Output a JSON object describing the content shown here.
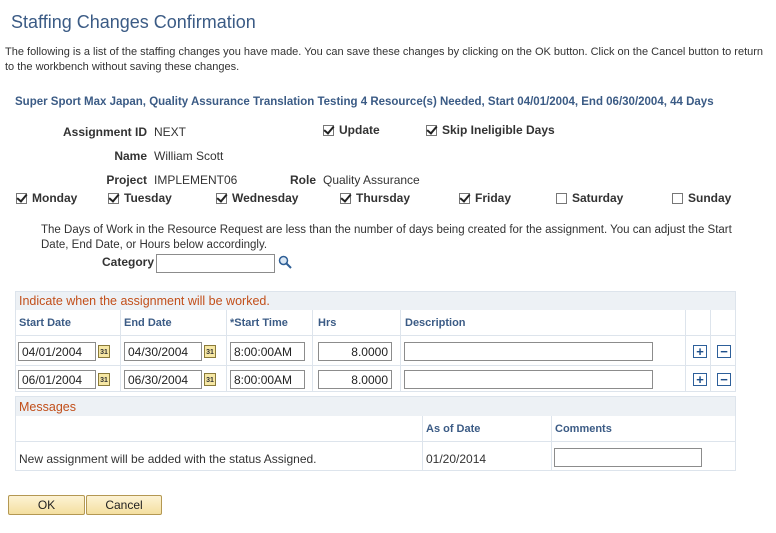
{
  "page": {
    "title": "Staffing Changes Confirmation",
    "intro": "The following is a list of the staffing changes you have made. You can save these changes by clicking on the OK button. Click on the Cancel button to return to the workbench without saving these changes.",
    "subheader": "Super Sport Max Japan, Quality Assurance Translation Testing 4 Resource(s) Needed, Start 04/01/2004, End 06/30/2004, 44 Days"
  },
  "assignment": {
    "id_label": "Assignment ID",
    "id_value": "NEXT",
    "name_label": "Name",
    "name_value": "William Scott",
    "project_label": "Project",
    "project_value": "IMPLEMENT06",
    "role_label": "Role",
    "role_value": "Quality Assurance",
    "update_label": "Update",
    "skip_label": "Skip Ineligible Days"
  },
  "days": [
    {
      "label": "Monday",
      "checked": true
    },
    {
      "label": "Tuesday",
      "checked": true
    },
    {
      "label": "Wednesday",
      "checked": true
    },
    {
      "label": "Thursday",
      "checked": true
    },
    {
      "label": "Friday",
      "checked": true
    },
    {
      "label": "Saturday",
      "checked": false
    },
    {
      "label": "Sunday",
      "checked": false
    }
  ],
  "notice": "The Days of Work in the Resource Request are less than the number of days being created for the assignment.  You can adjust the Start Date, End Date, or Hours below accordingly.",
  "category": {
    "label": "Category",
    "value": ""
  },
  "schedule": {
    "section_title": "Indicate when the assignment will be worked.",
    "columns": [
      "Start Date",
      "End Date",
      "*Start Time",
      "Hrs",
      "Description"
    ],
    "rows": [
      {
        "start": "04/01/2004",
        "end": "04/30/2004",
        "time": "8:00:00AM",
        "hrs": "8.0000",
        "desc": ""
      },
      {
        "start": "06/01/2004",
        "end": "06/30/2004",
        "time": "8:00:00AM",
        "hrs": "8.0000",
        "desc": ""
      }
    ],
    "calendar_icon_text": "31"
  },
  "messages": {
    "section_title": "Messages",
    "columns": [
      "",
      "As of Date",
      "Comments"
    ],
    "rows": [
      {
        "message": "New assignment will be added with the status Assigned.",
        "as_of_date": "01/20/2014",
        "comments": ""
      }
    ]
  },
  "buttons": {
    "ok": "OK",
    "cancel": "Cancel"
  }
}
